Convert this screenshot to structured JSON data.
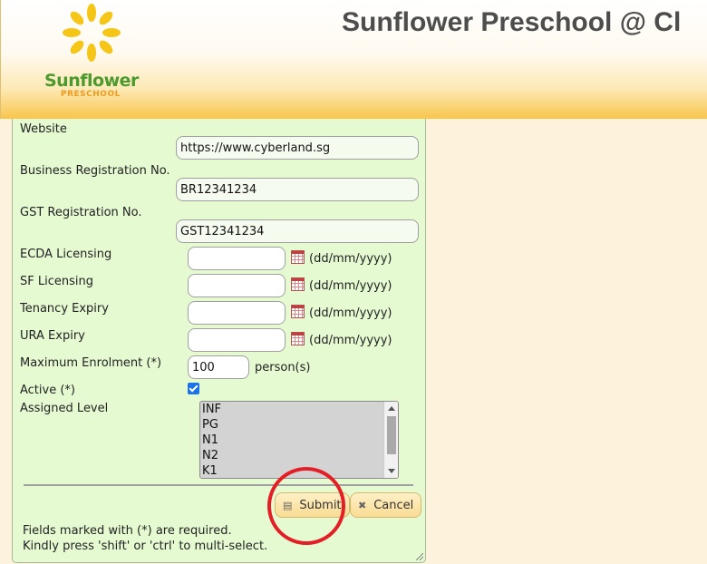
{
  "header": {
    "site_title": "Sunflower Preschool @ Cl",
    "logo_name": "Sunflower",
    "logo_subtitle": "PRESCHOOL"
  },
  "form": {
    "website": {
      "label": "Website",
      "value": "https://www.cyberland.sg"
    },
    "business_reg": {
      "label": "Business Registration No.",
      "value": "BR12341234"
    },
    "gst_reg": {
      "label": "GST Registration No.",
      "value": "GST12341234"
    },
    "ecda_licensing": {
      "label": "ECDA Licensing",
      "value": "",
      "hint": "(dd/mm/yyyy)"
    },
    "sf_licensing": {
      "label": "SF Licensing",
      "value": "",
      "hint": "(dd/mm/yyyy)"
    },
    "tenancy_expiry": {
      "label": "Tenancy Expiry",
      "value": "",
      "hint": "(dd/mm/yyyy)"
    },
    "ura_expiry": {
      "label": "URA Expiry",
      "value": "",
      "hint": "(dd/mm/yyyy)"
    },
    "max_enrolment": {
      "label": "Maximum Enrolment (*)",
      "value": "100",
      "unit": "person(s)"
    },
    "active": {
      "label": "Active (*)",
      "checked": true
    },
    "assigned_level": {
      "label": "Assigned Level",
      "options": [
        "INF",
        "PG",
        "N1",
        "N2",
        "K1"
      ]
    }
  },
  "buttons": {
    "submit_label": "Submit",
    "cancel_label": "Cancel"
  },
  "notes": {
    "line1": "Fields marked with (*) are required.",
    "line2": "Kindly press 'shift' or 'ctrl' to multi-select."
  },
  "icons": {
    "calendar": "calendar-icon",
    "submit": "save-icon",
    "cancel": "close-icon",
    "active_checkbox": "checkbox-checked"
  },
  "colors": {
    "panel_bg": "#e6fad2",
    "header_gold": "#f7c54a",
    "logo_green": "#4a9a2e",
    "logo_orange": "#f29a1e",
    "highlight_red": "#e41e26",
    "button_bg": "#f9dc94"
  }
}
